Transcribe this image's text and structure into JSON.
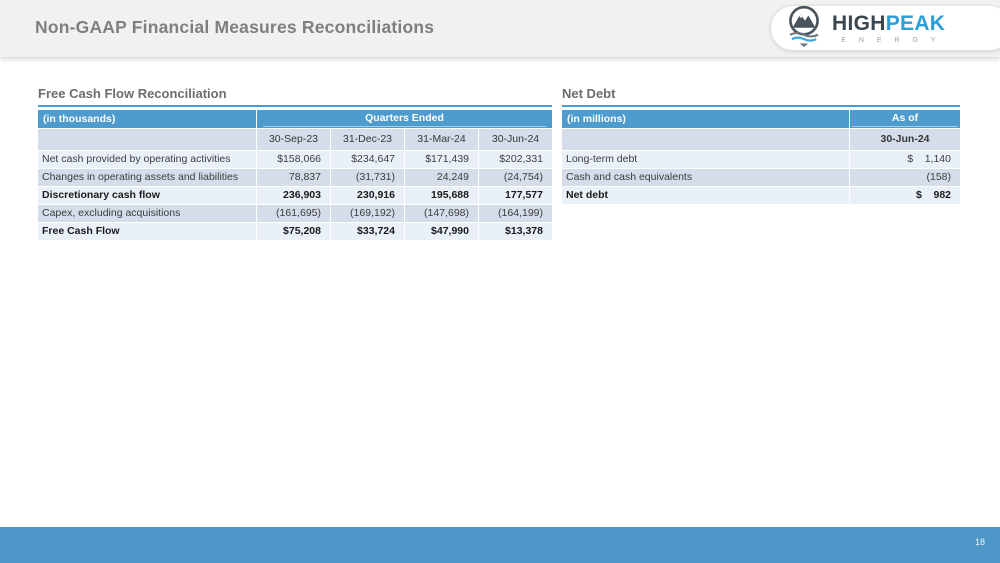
{
  "slide": {
    "title": "Non-GAAP Financial Measures Reconciliations",
    "page_number": "18"
  },
  "logo": {
    "icon": "mountain-icon",
    "brand_primary": "HIGH",
    "brand_secondary": "PEAK",
    "subtitle": "E N E R G Y"
  },
  "colors": {
    "band_bg": "#F1F1F0",
    "title_gray": "#7F7F7F",
    "table_header_blue": "#4E9BCD",
    "row_light": "#EAF0F8",
    "row_medium": "#D4DDE9",
    "footer_blue": "#4C96C8",
    "logo_blue": "#2E9CD6",
    "logo_dark": "#3A4750"
  },
  "fcf_table": {
    "title": "Free Cash Flow Reconciliation",
    "unit_label": "(in thousands)",
    "group_header": "Quarters Ended",
    "columns": [
      "30-Sep-23",
      "31-Dec-23",
      "31-Mar-24",
      "30-Jun-24"
    ],
    "rows": [
      {
        "label": "Net cash provided by operating activities",
        "bold": false,
        "values": [
          "$158,066",
          "$234,647",
          "$171,439",
          "$202,331"
        ]
      },
      {
        "label": "Changes in operating assets and liabilities",
        "bold": false,
        "values": [
          "78,837",
          "(31,731)",
          "24,249",
          "(24,754)"
        ]
      },
      {
        "label": "Discretionary cash flow",
        "bold": true,
        "values": [
          "236,903",
          "230,916",
          "195,688",
          "177,577"
        ]
      },
      {
        "label": "Capex, excluding acquisitions",
        "bold": false,
        "values": [
          "(161,695)",
          "(169,192)",
          "(147,698)",
          "(164,199)"
        ]
      },
      {
        "label": "Free Cash Flow",
        "bold": true,
        "values": [
          "$75,208",
          "$33,724",
          "$47,990",
          "$13,378"
        ]
      }
    ]
  },
  "net_debt_table": {
    "title": "Net Debt",
    "unit_label": "(in millions)",
    "group_header": "As of",
    "columns": [
      "30-Jun-24"
    ],
    "rows": [
      {
        "label": "Long-term debt",
        "bold": false,
        "value": "$    1,140"
      },
      {
        "label": "Cash and cash equivalents",
        "bold": false,
        "value": "(158)"
      },
      {
        "label": "Net debt",
        "bold": true,
        "value": "$    982"
      }
    ]
  }
}
